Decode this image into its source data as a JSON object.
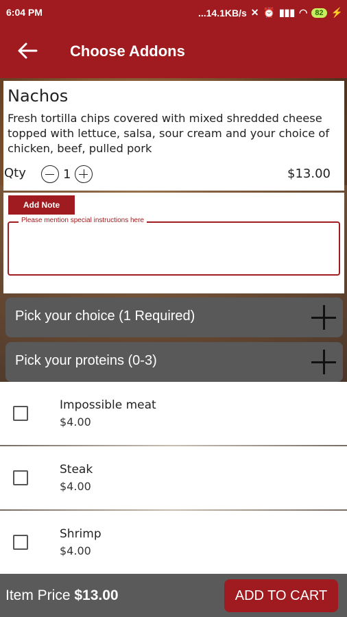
{
  "status": {
    "time": "6:04 PM",
    "network": "...14.1KB/s",
    "battery": "82"
  },
  "header": {
    "title": "Choose Addons"
  },
  "item": {
    "name": "Nachos",
    "description": "Fresh tortilla chips covered with mixed shredded cheese topped with lettuce, salsa, sour cream and your choice of chicken, beef, pulled pork",
    "qty_label": "Qty",
    "qty_value": "1",
    "price": "$13.00"
  },
  "note": {
    "button_label": "Add Note",
    "placeholder": "Please mention special instructions here"
  },
  "sections": [
    {
      "label": "Pick your choice (1 Required)"
    },
    {
      "label": "Pick your proteins (0-3)"
    }
  ],
  "options": [
    {
      "name": "Impossible meat",
      "price": "$4.00"
    },
    {
      "name": "Steak",
      "price": "$4.00"
    },
    {
      "name": "Shrimp",
      "price": "$4.00"
    }
  ],
  "footer": {
    "item_price_label": "Item Price",
    "item_price_value": "$13.00",
    "add_to_cart_label": "ADD TO CART"
  }
}
